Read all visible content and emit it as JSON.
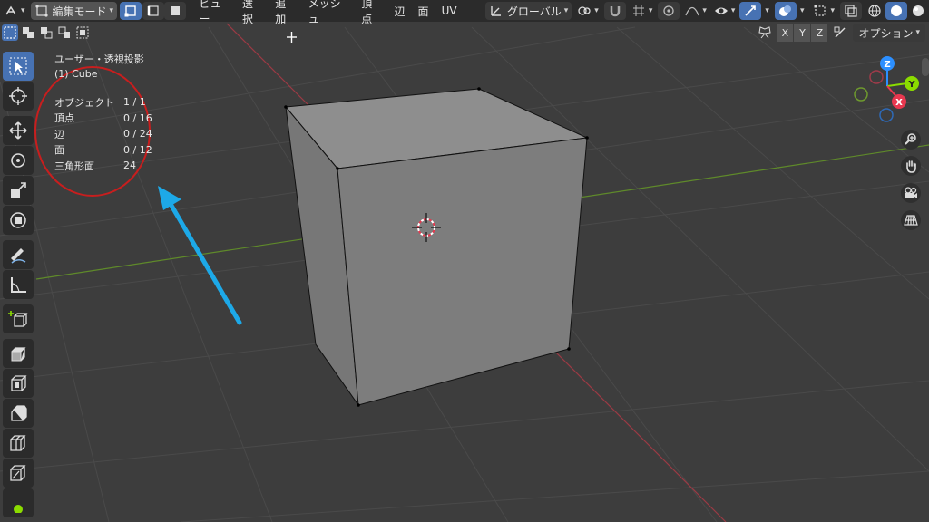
{
  "header": {
    "mode_label": "編集モード",
    "menus": [
      "ビュー",
      "選択",
      "追加",
      "メッシュ",
      "頂点",
      "辺",
      "面",
      "UV"
    ],
    "transform_orientation": "グローバル"
  },
  "row2": {
    "axes": [
      "X",
      "Y",
      "Z"
    ],
    "options_label": "オプション"
  },
  "viewport": {
    "view_name": "ユーザー・透視投影",
    "object_name": "(1) Cube"
  },
  "stats": [
    {
      "label": "オブジェクト",
      "value": "1 / 1"
    },
    {
      "label": "頂点",
      "value": "0 / 16"
    },
    {
      "label": "辺",
      "value": "0 / 24"
    },
    {
      "label": "面",
      "value": "0 / 12"
    },
    {
      "label": "三角形面",
      "value": "24"
    }
  ],
  "gizmo": {
    "z": "Z",
    "y": "Y",
    "x": "X"
  },
  "colors": {
    "accent": "#4772b3",
    "x_axis": "#e8384f",
    "y_axis": "#8bdc00",
    "z_axis": "#2c8fff",
    "annotation_circle": "#c81e1e",
    "annotation_arrow": "#1da9e8"
  }
}
